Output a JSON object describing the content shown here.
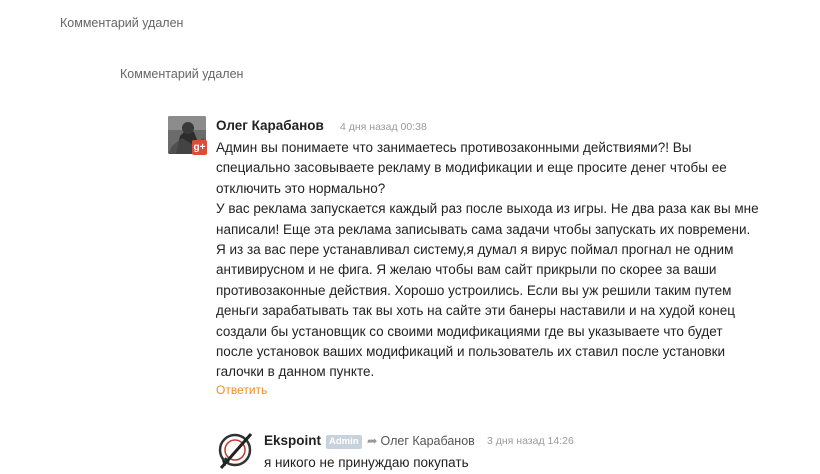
{
  "deleted_1": "Комментарий удален",
  "deleted_2": "Комментарий удален",
  "comment": {
    "author": "Олег Карабанов",
    "time": "4 дня назад 00:38",
    "lines": [
      "Админ вы понимаете что занимаетесь противозаконными действиями?! Вы",
      "специально засовываете рекламу в модификации  и еще просите денег чтобы ее",
      "отключить это нормально?",
      "У вас реклама запускается каждый раз после выхода из игры. Не два раза как вы мне",
      "написали! Еще эта реклама записывать сама задачи чтобы запускать их повремени.",
      "Я из за вас пере устанавливал систему,я думал я вирус поймал прогнал не одним",
      "антивирусном и не фига. Я желаю чтобы вам сайт прикрыли по скорее за ваши",
      "противозаконные действия. Хорошо устроились. Если вы уж решили таким путем",
      "деньги зарабатывать так вы хоть на сайте эти банеры наставили и на худой конец",
      "создали бы установщик со своими модификациями где вы указываете что будет",
      "после установок ваших модификаций и пользователь их ставил после установки",
      "галочки в данном пункте."
    ],
    "reply_label": "Ответить",
    "gplus_label": "g+"
  },
  "reply": {
    "author": "Ekspoint",
    "badge": "Admin",
    "reply_to": "Олег Карабанов",
    "time": "3 дня назад 14:26",
    "text": "я никого не принуждаю покупать"
  },
  "colors": {
    "link": "#e8912a",
    "gplus": "#dd4b39",
    "badge": "#c8d2dd"
  }
}
